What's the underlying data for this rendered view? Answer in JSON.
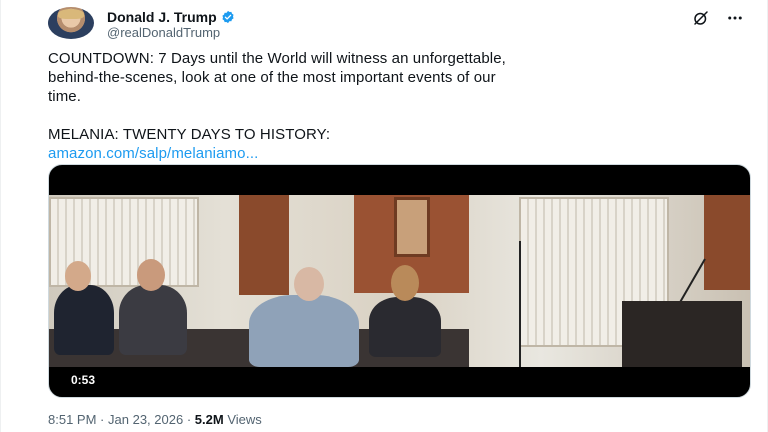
{
  "author": {
    "name": "Donald J. Trump",
    "handle": "@realDonaldTrump",
    "verified": true
  },
  "tweet": {
    "line1": "COUNTDOWN: 7 Days until the World will witness an unforgettable,",
    "line2": "behind-the-scenes, look at one of the most important events of our",
    "line3": "time.",
    "line4": "MELANIA: TWENTY DAYS TO HISTORY:",
    "link": "amazon.com/salp/melaniamo..."
  },
  "media": {
    "duration": "0:53"
  },
  "meta": {
    "time": "8:51 PM",
    "separator": "·",
    "date": "Jan 23, 2026",
    "views_count": "5.2M",
    "views_label": "Views"
  },
  "icons": {
    "verified": "verified-badge-icon",
    "grok": "grok-icon",
    "more": "more-icon"
  },
  "colors": {
    "link": "#1d9bf0",
    "verified": "#1d9bf0",
    "secondary_text": "#536471"
  }
}
